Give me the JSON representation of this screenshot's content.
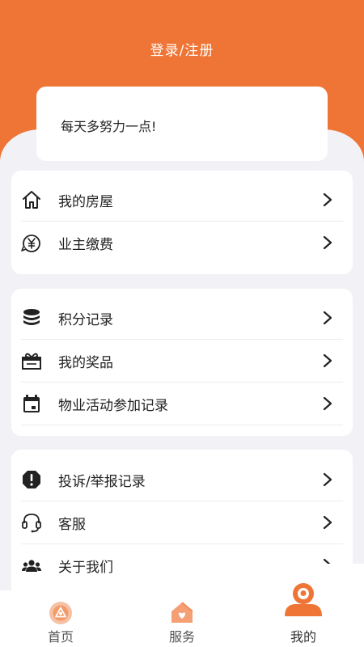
{
  "header": {
    "login_label": "登录/注册"
  },
  "motto": {
    "text": "每天多努力一点!"
  },
  "group1": {
    "items": [
      {
        "label": "我的房屋",
        "icon": "house-icon"
      },
      {
        "label": "业主缴费",
        "icon": "yen-payment-icon"
      }
    ]
  },
  "group2": {
    "items": [
      {
        "label": "积分记录",
        "icon": "coins-icon"
      },
      {
        "label": "我的奖品",
        "icon": "gift-icon"
      },
      {
        "label": "物业活动参加记录",
        "icon": "calendar-icon"
      }
    ]
  },
  "group3": {
    "items": [
      {
        "label": "投诉/举报记录",
        "icon": "alert-octagon-icon"
      },
      {
        "label": "客服",
        "icon": "headset-icon"
      },
      {
        "label": "关于我们",
        "icon": "users-icon"
      }
    ]
  },
  "tabbar": {
    "tabs": [
      {
        "label": "首页",
        "icon": "home-tab-icon"
      },
      {
        "label": "服务",
        "icon": "service-tab-icon"
      },
      {
        "label": "我的",
        "icon": "profile-tab-icon",
        "active": true
      }
    ]
  },
  "colors": {
    "accent": "#ee7536",
    "background": "#f2f2f6",
    "text": "#222222"
  }
}
